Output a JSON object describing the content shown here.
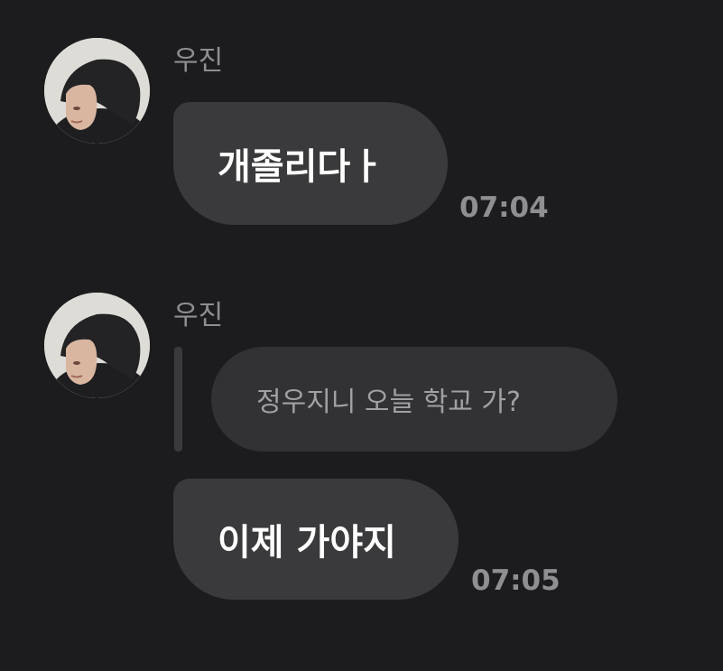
{
  "messages": [
    {
      "sender": "우진",
      "text": "개졸리다ㅏ",
      "time": "07:04"
    },
    {
      "sender": "우진",
      "quoted": "정우지니 오늘 학교 가?",
      "text": "이제 가야지",
      "time": "07:05"
    }
  ],
  "colors": {
    "background": "#1c1c1e",
    "bubble": "#3a3a3c",
    "reply_bubble": "#323234",
    "secondary_text": "#8e8e93",
    "primary_text": "#ffffff"
  },
  "icons": {
    "avatar": "profile-photo"
  }
}
